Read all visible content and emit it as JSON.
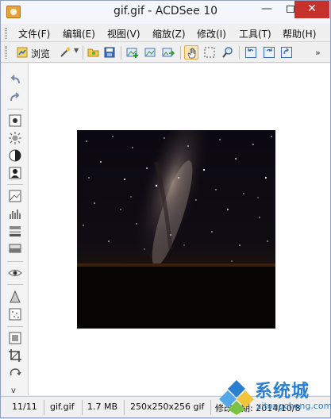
{
  "window": {
    "title": "gif.gif - ACDSee 10",
    "min_glyph": "—",
    "close_glyph": "✕"
  },
  "menu": {
    "items": [
      "文件(F)",
      "编辑(E)",
      "视图(V)",
      "缩放(Z)",
      "修改(I)",
      "工具(T)",
      "帮助(H)"
    ]
  },
  "toolbar": {
    "browse_label": "浏览",
    "more_glyph": "»"
  },
  "leftbar": {
    "more_glyph": "v"
  },
  "status": {
    "index": "11/11",
    "filename": "gif.gif",
    "filesize": "1.7 MB",
    "dimensions": "250x250x256 gif",
    "modified": "修改日期: 2014/10/8"
  },
  "watermark": {
    "text": "系统城",
    "sub": "xitongcheng.com"
  },
  "colors": {
    "close": "#c7312c",
    "accent": "#2a7fcf",
    "active_tool": "#fde6b7"
  }
}
